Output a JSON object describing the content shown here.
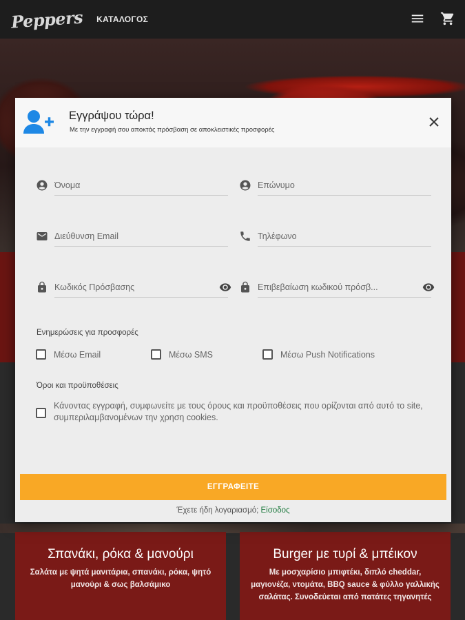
{
  "header": {
    "logo_text": "Peppers",
    "nav_catalog": "ΚΑΤΑΛΟΓΟΣ",
    "icons": [
      "menu-icon",
      "cart-icon"
    ]
  },
  "modal": {
    "title": "Εγγράψου τώρα!",
    "subtitle": "Με την εγγραφή σου αποκτάς πρόσβαση σε αποκλειστικές προσφορές",
    "fields": {
      "first_name": {
        "placeholder": "Όνομα",
        "icon": "person-icon"
      },
      "last_name": {
        "placeholder": "Επώνυμο",
        "icon": "person-icon"
      },
      "email": {
        "placeholder": "Διεύθυνση Email",
        "icon": "mail-icon"
      },
      "phone": {
        "placeholder": "Τηλέφωνο",
        "icon": "phone-icon"
      },
      "password": {
        "placeholder": "Κωδικός Πρόσβασης",
        "icon": "lock-icon"
      },
      "password_confirm": {
        "placeholder": "Επιβεβαίωση κωδικού πρόσβ...",
        "icon": "lock-icon"
      }
    },
    "offers_label": "Ενημερώσεις για προσφορές",
    "offers": {
      "email": "Μέσω Email",
      "sms": "Μέσω SMS",
      "push": "Μέσω Push Notifications"
    },
    "terms_label": "Όροι και προϋποθέσεις",
    "terms_text": "Κάνοντας εγγραφή, συμφωνείτε με τους όρους και προϋποθέσεις που ορίζονται από αυτό το site, συμπεριλαμβανομένων την χρηση cookies.",
    "submit_label": "ΕΓΓΡΑΦΕΙΤΕ",
    "login_prompt": "Έχετε ήδη λογαριασμό;",
    "login_link": "Είσοδος"
  },
  "cards": [
    {
      "title": "Σπανάκι, ρόκα & μανούρι",
      "description": "Σαλάτα με ψητά μανιτάρια, σπανάκι, ρόκα, ψητό μανούρι & σως βαλσάμικο"
    },
    {
      "title": "Burger με τυρί & μπέικον",
      "description": "Με μοσχαρίσιο μπιφτέκι, διπλό cheddar, μαγιονέζα, ντομάτα, BBQ sauce & φύλλο γαλλικής σαλάτας. Συνοδεύεται από πατάτες τηγανητές"
    }
  ],
  "colors": {
    "accent": "#f9a825",
    "link": "#1f7a3f",
    "user_icon": "#1e88e5",
    "card_bg": "#7a1a17"
  }
}
